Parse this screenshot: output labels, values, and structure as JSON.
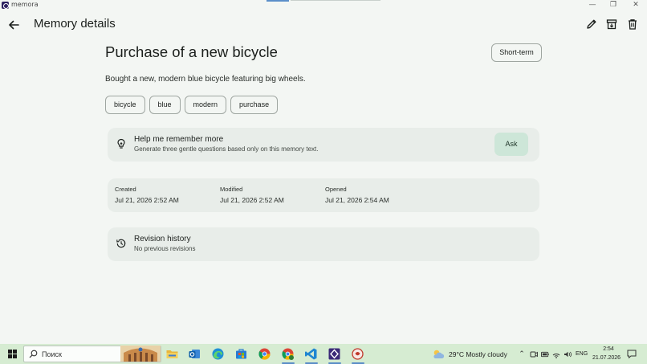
{
  "window": {
    "app_name": "memora",
    "minimize": "—",
    "maximize": "❐",
    "close": "✕"
  },
  "header": {
    "title": "Memory details",
    "icons": [
      "back-arrow-icon",
      "pencil-icon",
      "archive-icon",
      "trash-icon"
    ]
  },
  "memory": {
    "title": "Purchase of a new bicycle",
    "term_label": "Short-term",
    "description": "Bought a new, modern blue bicycle featuring big wheels.",
    "tags": [
      "bicycle",
      "blue",
      "modern",
      "purchase"
    ]
  },
  "help_card": {
    "title": "Help me remember more",
    "subtitle": "Generate three gentle questions based only on this memory text.",
    "ask_label": "Ask",
    "icon": "lightbulb-icon"
  },
  "dates": {
    "created_label": "Created",
    "created_value": "Jul 21, 2026 2:52 AM",
    "modified_label": "Modified",
    "modified_value": "Jul 21, 2026 2:52 AM",
    "opened_label": "Opened",
    "opened_value": "Jul 21, 2026 2:54 AM"
  },
  "revision": {
    "title": "Revision history",
    "subtitle": "No previous revisions",
    "icon": "history-icon"
  },
  "taskbar": {
    "search_placeholder": "Поиск",
    "weather": "29°C  Mostly cloudy",
    "language": "ENG",
    "time": "2:54",
    "date": "21.07.2026",
    "accent": "#5a8dc7",
    "background": "#d6ecd2"
  },
  "colors": {
    "background": "#f3f6f3",
    "card": "#e8ede9",
    "ask_button": "#cde6d8"
  }
}
